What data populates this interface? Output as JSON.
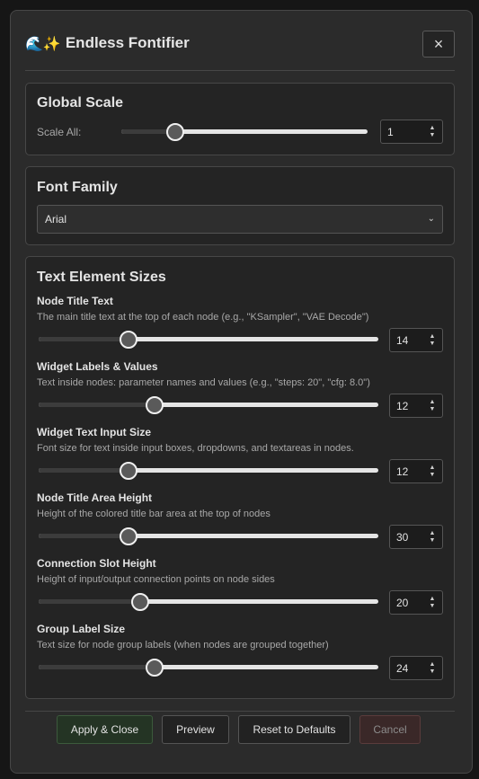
{
  "dialog": {
    "title_emoji": "🌊✨",
    "title": "Endless Fontifier",
    "close_label": "×"
  },
  "global_scale": {
    "title": "Global Scale",
    "label": "Scale All:",
    "value": "1",
    "slider_fraction": 0.22
  },
  "font_family": {
    "title": "Font Family",
    "selected": "Arial"
  },
  "text_sizes": {
    "title": "Text Element Sizes",
    "items": [
      {
        "title": "Node Title Text",
        "desc": "The main title text at the top of each node (e.g., \"KSampler\", \"VAE Decode\")",
        "value": "14",
        "slider_fraction": 0.264
      },
      {
        "title": "Widget Labels & Values",
        "desc": "Text inside nodes: parameter names and values (e.g., \"steps: 20\", \"cfg: 8.0\")",
        "value": "12",
        "slider_fraction": 0.342
      },
      {
        "title": "Widget Text Input Size",
        "desc": "Font size for text inside input boxes, dropdowns, and textareas in nodes.",
        "value": "12",
        "slider_fraction": 0.264
      },
      {
        "title": "Node Title Area Height",
        "desc": "Height of the colored title bar area at the top of nodes",
        "value": "30",
        "slider_fraction": 0.264
      },
      {
        "title": "Connection Slot Height",
        "desc": "Height of input/output connection points on node sides",
        "value": "20",
        "slider_fraction": 0.298
      },
      {
        "title": "Group Label Size",
        "desc": "Text size for node group labels (when nodes are grouped together)",
        "value": "24",
        "slider_fraction": 0.342
      }
    ]
  },
  "footer": {
    "apply_label": "Apply & Close",
    "preview_label": "Preview",
    "reset_label": "Reset to Defaults",
    "cancel_label": "Cancel"
  }
}
